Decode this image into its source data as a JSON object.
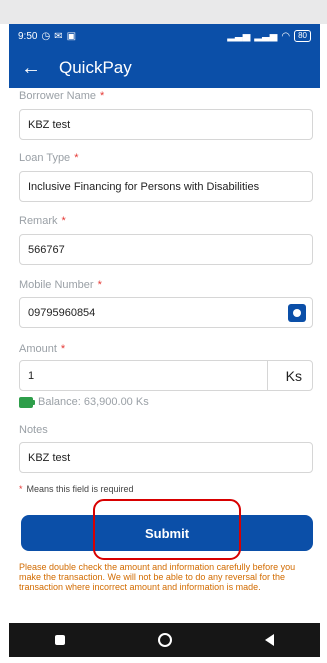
{
  "status": {
    "time": "9:50",
    "battery": "80"
  },
  "header": {
    "title": "QuickPay",
    "back_icon": "arrow-left-icon"
  },
  "form": {
    "borrower_label": "Borrower Name",
    "borrower_value": "KBZ test",
    "loan_type_label": "Loan Type",
    "loan_type_value": "Inclusive Financing for Persons with Disabilities",
    "remark_label": "Remark",
    "remark_value": "566767",
    "mobile_label": "Mobile Number",
    "mobile_value": "09795960854",
    "amount_label": "Amount",
    "amount_value": "1",
    "currency": "Ks",
    "balance": "Balance: 63,900.00 Ks",
    "notes_label": "Notes",
    "notes_value": "KBZ test",
    "required_marker": "*",
    "required_note": "Means this field is required"
  },
  "actions": {
    "submit_label": "Submit"
  },
  "warning": "Please double check the amount and information carefully before you make the transaction. We will not be able to do any reversal for the transaction where incorrect amount and information is made.",
  "colors": {
    "primary": "#0b4fa8",
    "required": "#e53935",
    "warning": "#d26b00",
    "highlight": "#d80000"
  }
}
